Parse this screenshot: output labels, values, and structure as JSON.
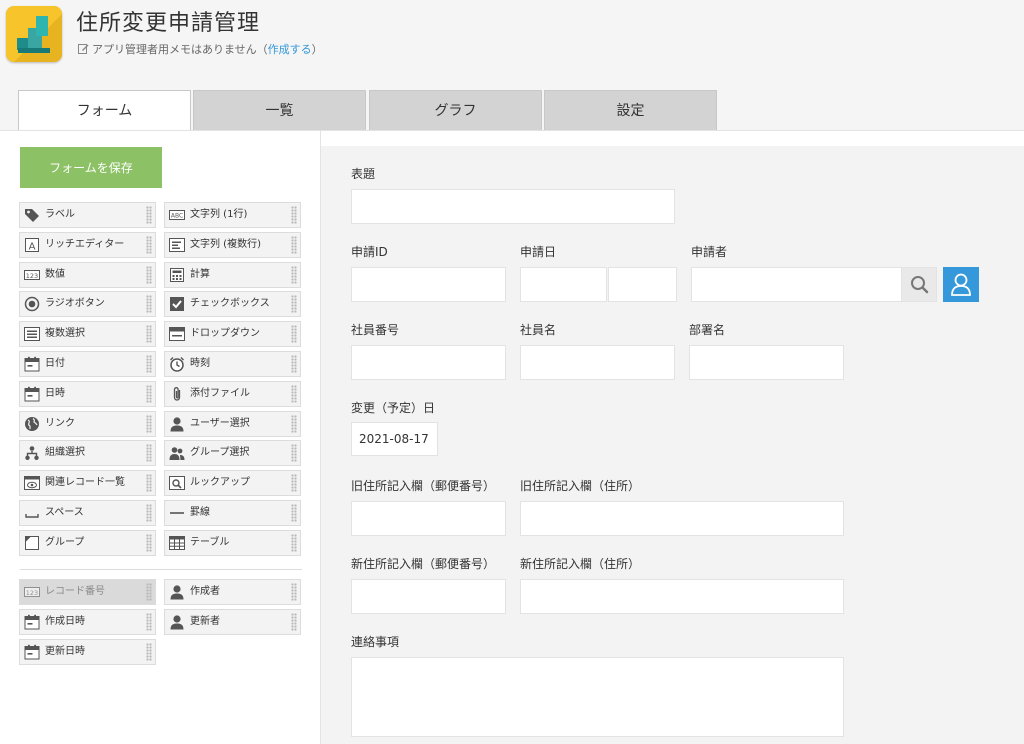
{
  "app": {
    "title": "住所変更申請管理",
    "memo_text": "アプリ管理者用メモはありません（",
    "memo_link": "作成する",
    "memo_close": "）"
  },
  "tabs": [
    {
      "label": "フォーム",
      "active": true
    },
    {
      "label": "一覧",
      "active": false
    },
    {
      "label": "グラフ",
      "active": false
    },
    {
      "label": "設定",
      "active": false
    }
  ],
  "palette": {
    "save_label": "フォームを保存",
    "fields": [
      {
        "label": "ラベル",
        "icon": "tag-icon"
      },
      {
        "label": "文字列 (1行)",
        "icon": "abc-icon"
      },
      {
        "label": "リッチエディター",
        "icon": "rich-text-icon"
      },
      {
        "label": "文字列 (複数行)",
        "icon": "multiline-text-icon"
      },
      {
        "label": "数値",
        "icon": "number-icon"
      },
      {
        "label": "計算",
        "icon": "calculator-icon"
      },
      {
        "label": "ラジオボタン",
        "icon": "radio-icon"
      },
      {
        "label": "チェックボックス",
        "icon": "checkbox-icon"
      },
      {
        "label": "複数選択",
        "icon": "multi-select-icon"
      },
      {
        "label": "ドロップダウン",
        "icon": "dropdown-icon"
      },
      {
        "label": "日付",
        "icon": "calendar-icon"
      },
      {
        "label": "時刻",
        "icon": "clock-icon"
      },
      {
        "label": "日時",
        "icon": "calendar-icon"
      },
      {
        "label": "添付ファイル",
        "icon": "paperclip-icon"
      },
      {
        "label": "リンク",
        "icon": "globe-icon"
      },
      {
        "label": "ユーザー選択",
        "icon": "user-icon"
      },
      {
        "label": "組織選択",
        "icon": "org-icon"
      },
      {
        "label": "グループ選択",
        "icon": "group-icon"
      },
      {
        "label": "関連レコード一覧",
        "icon": "related-records-icon"
      },
      {
        "label": "ルックアップ",
        "icon": "lookup-icon"
      },
      {
        "label": "スペース",
        "icon": "space-icon"
      },
      {
        "label": "罫線",
        "icon": "line-icon"
      },
      {
        "label": "グループ",
        "icon": "group-box-icon"
      },
      {
        "label": "テーブル",
        "icon": "table-icon"
      }
    ],
    "system_fields": [
      {
        "label": "レコード番号",
        "icon": "number-icon",
        "disabled": true
      },
      {
        "label": "作成者",
        "icon": "user-icon",
        "disabled": false
      },
      {
        "label": "作成日時",
        "icon": "calendar-icon",
        "disabled": false
      },
      {
        "label": "更新者",
        "icon": "user-icon",
        "disabled": false
      },
      {
        "label": "更新日時",
        "icon": "calendar-icon",
        "disabled": false
      }
    ]
  },
  "form": {
    "title_label": "表題",
    "request_id_label": "申請ID",
    "request_date_label": "申請日",
    "applicant_label": "申請者",
    "employee_no_label": "社員番号",
    "employee_name_label": "社員名",
    "department_label": "部署名",
    "change_date_label": "変更（予定）日",
    "change_date_value": "2021-08-17",
    "old_zip_label": "旧住所記入欄（郵便番号）",
    "old_address_label": "旧住所記入欄（住所）",
    "new_zip_label": "新住所記入欄（郵便番号）",
    "new_address_label": "新住所記入欄（住所）",
    "notes_label": "連絡事項"
  },
  "colors": {
    "save_button": "#8cc265",
    "accent_blue": "#3498db",
    "app_icon_bg": "#f7c52b"
  }
}
